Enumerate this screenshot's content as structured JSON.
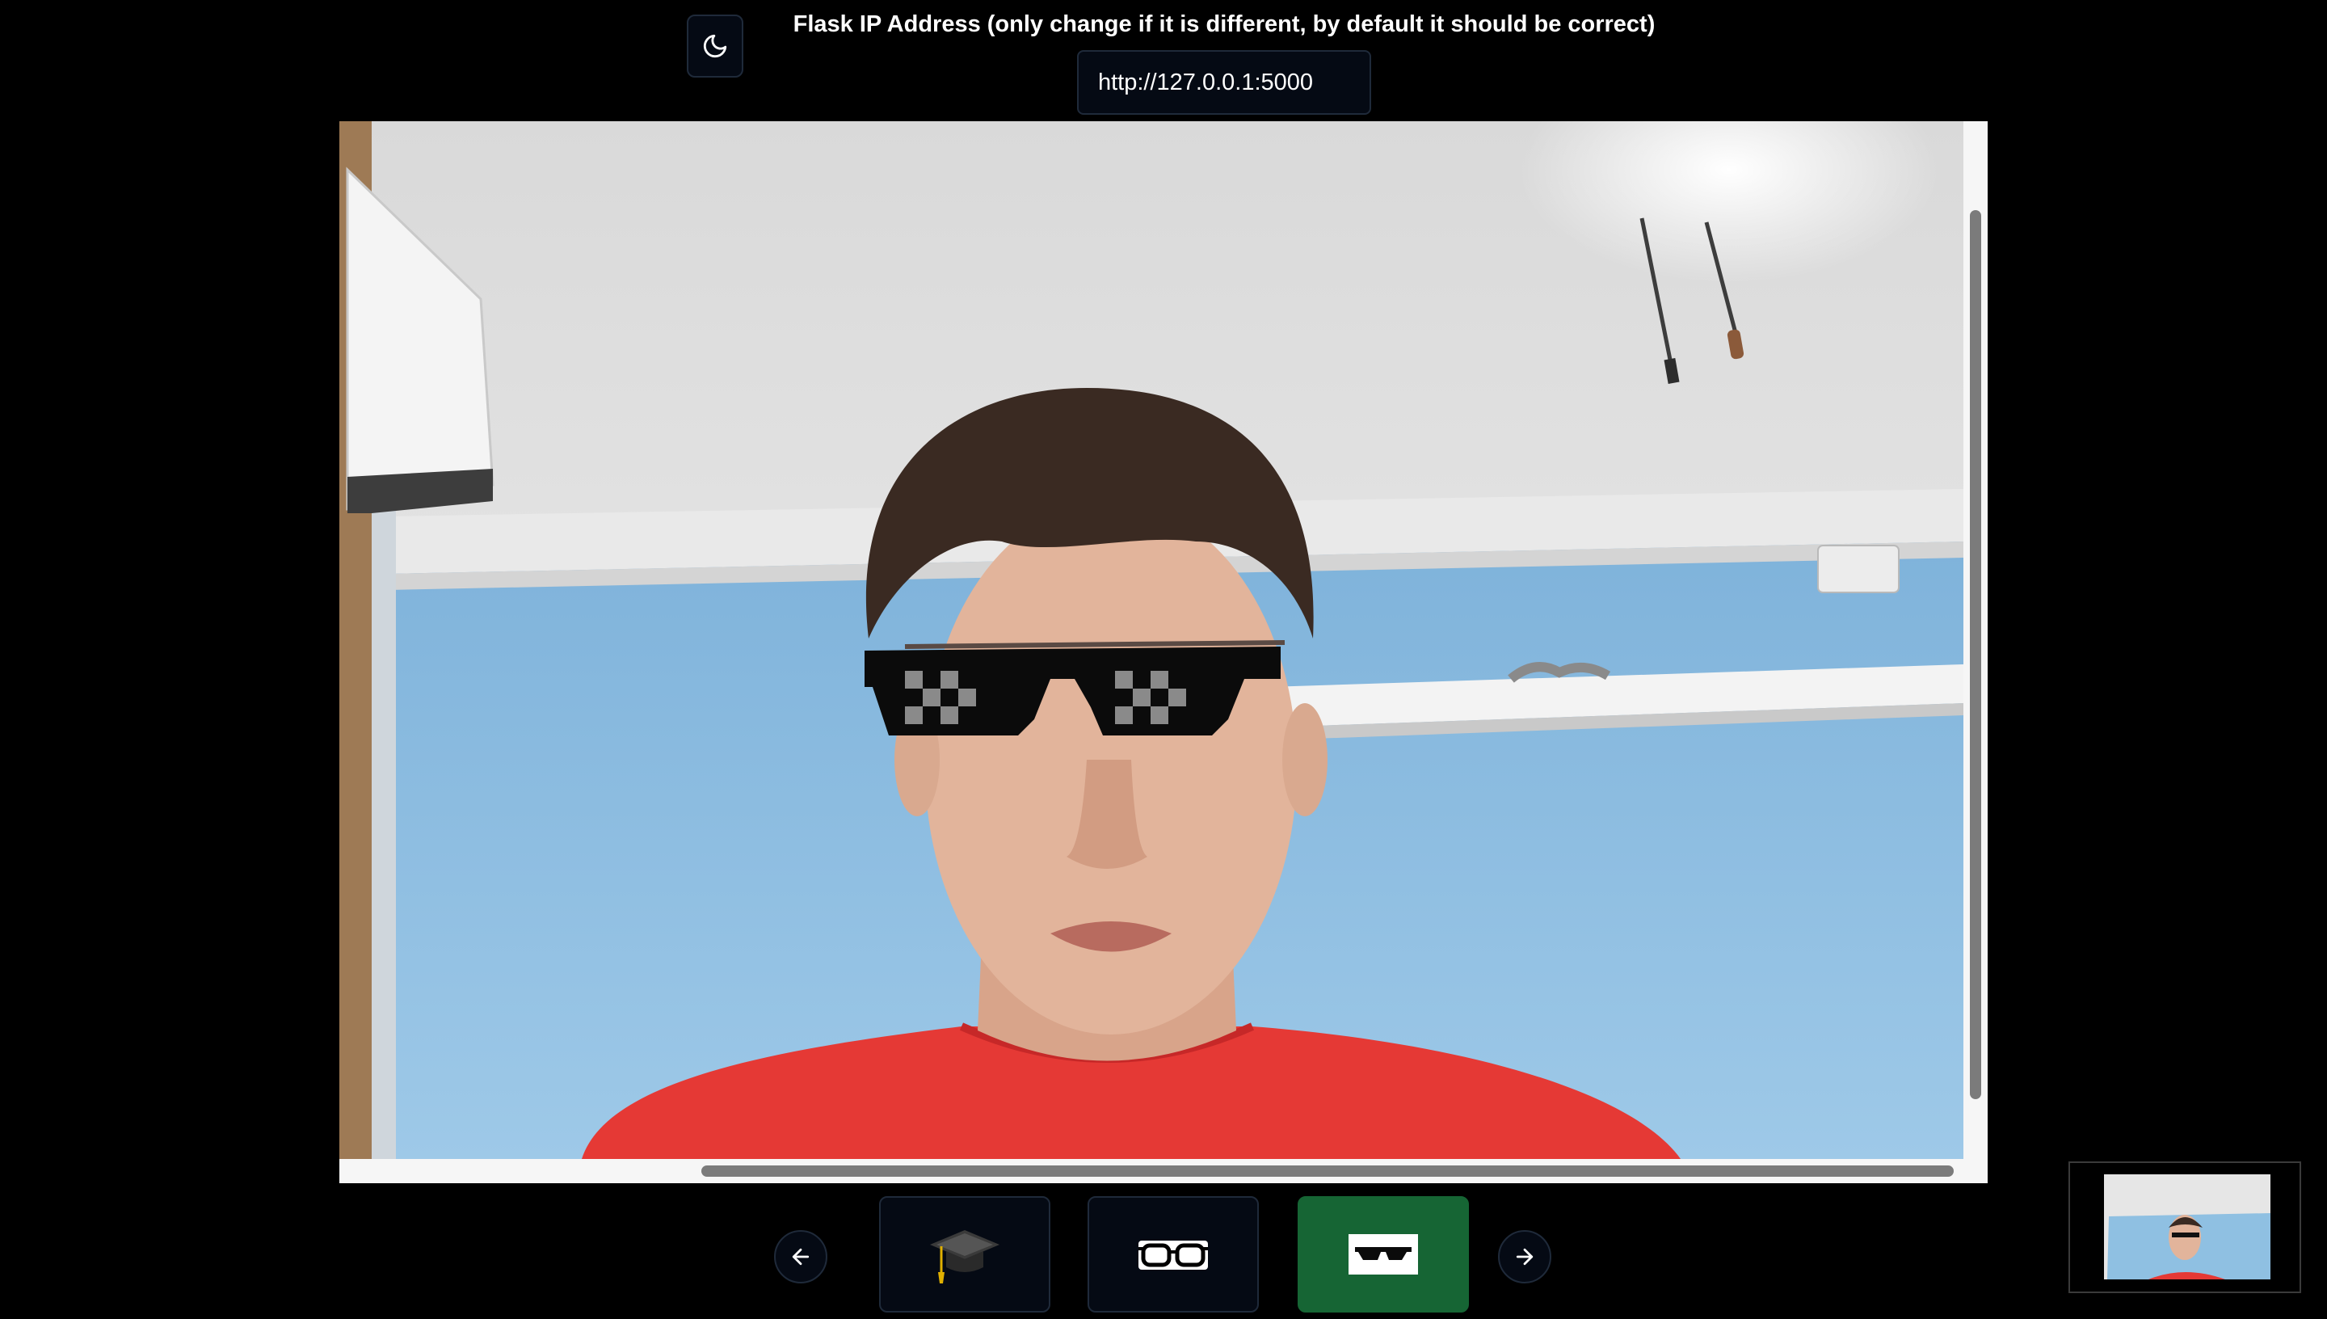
{
  "header": {
    "ip_label": "Flask IP Address (only change if it is different, by default it should be correct)",
    "ip_value": "http://127.0.0.1:5000"
  },
  "icons": {
    "theme_toggle": "moon-icon",
    "prev": "arrow-left-icon",
    "next": "arrow-right-icon"
  },
  "filters": [
    {
      "icon": "graduation-cap-icon",
      "selected": false
    },
    {
      "icon": "glasses-icon",
      "selected": false
    },
    {
      "icon": "pixel-sunglasses-icon",
      "selected": true
    }
  ],
  "colors": {
    "background": "#000000",
    "button_bg": "#050a14",
    "button_border": "#1f2a3a",
    "selected_filter": "#166534",
    "wall_blue": "#8fc0e2",
    "shirt_red": "#e53935"
  }
}
